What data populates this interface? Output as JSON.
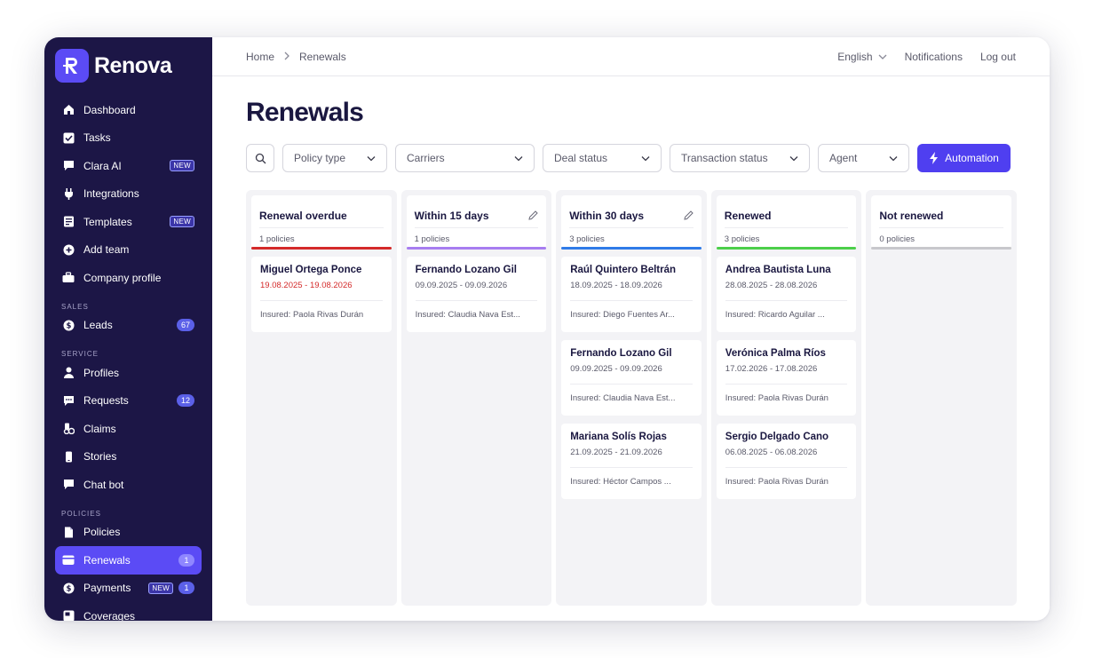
{
  "brand": {
    "name": "Renova"
  },
  "sidebar": {
    "items_top": [
      {
        "label": "Dashboard",
        "icon": "home-icon"
      },
      {
        "label": "Tasks",
        "icon": "checkbox-icon"
      },
      {
        "label": "Clara AI",
        "icon": "chat-icon",
        "badge": "NEW"
      },
      {
        "label": "Integrations",
        "icon": "plug-icon"
      },
      {
        "label": "Templates",
        "icon": "template-icon",
        "badge": "NEW"
      },
      {
        "label": "Add team",
        "icon": "plus-circle-icon"
      },
      {
        "label": "Company profile",
        "icon": "briefcase-icon"
      }
    ],
    "sections": [
      {
        "label": "SALES",
        "items": [
          {
            "label": "Leads",
            "icon": "dollar-icon",
            "count": "67"
          }
        ]
      },
      {
        "label": "SERVICE",
        "items": [
          {
            "label": "Profiles",
            "icon": "user-icon"
          },
          {
            "label": "Requests",
            "icon": "message-icon",
            "count": "12"
          },
          {
            "label": "Claims",
            "icon": "claims-icon"
          },
          {
            "label": "Stories",
            "icon": "phone-icon"
          },
          {
            "label": "Chat bot",
            "icon": "chat-icon"
          }
        ]
      },
      {
        "label": "POLICIES",
        "items": [
          {
            "label": "Policies",
            "icon": "document-icon"
          },
          {
            "label": "Renewals",
            "icon": "wallet-icon",
            "count": "1",
            "active": true
          },
          {
            "label": "Payments",
            "icon": "dollar-icon",
            "badge": "NEW",
            "count": "1"
          },
          {
            "label": "Coverages",
            "icon": "coverage-icon"
          }
        ]
      }
    ]
  },
  "topbar": {
    "breadcrumb": [
      "Home",
      "Renewals"
    ],
    "language": "English",
    "notifications": "Notifications",
    "logout": "Log out"
  },
  "page": {
    "title": "Renewals"
  },
  "filters": {
    "items": [
      "Policy type",
      "Carriers",
      "Deal status",
      "Transaction status",
      "Agent"
    ],
    "automation": "Automation"
  },
  "colors": {
    "overdue": "#d42a2a",
    "within15": "#a77df0",
    "within30": "#2f7be8",
    "renewed": "#4ccf4a",
    "notRenewed": "#c8c8cc",
    "accent": "#4f3ff0",
    "sidebar": "#1c1646"
  },
  "columns": [
    {
      "title": "Renewal overdue",
      "count": "1 policies",
      "color": "#d42a2a",
      "editable": false,
      "cards": [
        {
          "name": "Miguel Ortega Ponce",
          "dates": "19.08.2025 - 19.08.2026",
          "insured": "Insured: Paola Rivas Durán",
          "overdue": true
        }
      ]
    },
    {
      "title": "Within 15 days",
      "count": "1 policies",
      "color": "#a77df0",
      "editable": true,
      "cards": [
        {
          "name": "Fernando Lozano Gil",
          "dates": "09.09.2025 - 09.09.2026",
          "insured": "Insured: Claudia Nava Est..."
        }
      ]
    },
    {
      "title": "Within 30 days",
      "count": "3 policies",
      "color": "#2f7be8",
      "editable": true,
      "cards": [
        {
          "name": "Raúl Quintero Beltrán",
          "dates": "18.09.2025 - 18.09.2026",
          "insured": "Insured: Diego Fuentes Ar..."
        },
        {
          "name": "Fernando Lozano Gil",
          "dates": "09.09.2025 - 09.09.2026",
          "insured": "Insured: Claudia Nava Est..."
        },
        {
          "name": "Mariana Solís Rojas",
          "dates": "21.09.2025 - 21.09.2026",
          "insured": "Insured: Héctor Campos ..."
        }
      ]
    },
    {
      "title": "Renewed",
      "count": "3 policies",
      "color": "#4ccf4a",
      "editable": false,
      "cards": [
        {
          "name": "Andrea Bautista Luna",
          "dates": "28.08.2025 - 28.08.2026",
          "insured": "Insured: Ricardo Aguilar ..."
        },
        {
          "name": "Verónica Palma Ríos",
          "dates": "17.02.2026 - 17.08.2026",
          "insured": "Insured: Paola Rivas Durán"
        },
        {
          "name": "Sergio Delgado Cano",
          "dates": "06.08.2025 - 06.08.2026",
          "insured": "Insured: Paola Rivas Durán"
        }
      ]
    },
    {
      "title": "Not renewed",
      "count": "0 policies",
      "color": "#c8c8cc",
      "editable": false,
      "cards": []
    }
  ]
}
